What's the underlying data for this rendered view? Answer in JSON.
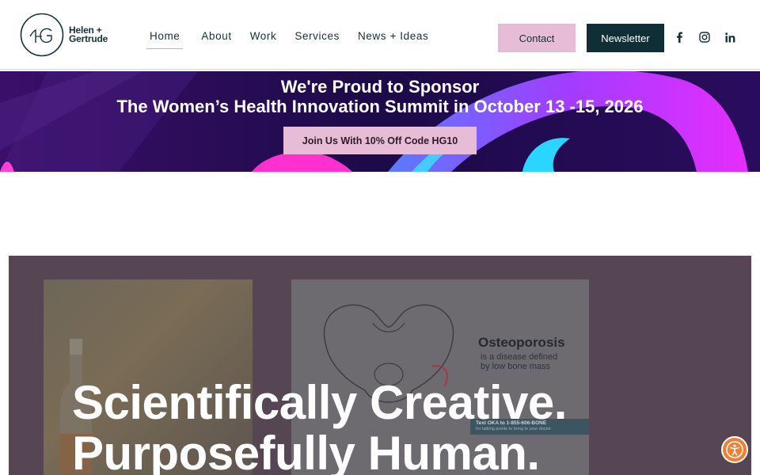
{
  "logo": {
    "monogram": "HG",
    "line1": "Helen +",
    "line2": "Gertrude"
  },
  "nav": {
    "items": [
      {
        "label": "Home",
        "active": true
      },
      {
        "label": "About"
      },
      {
        "label": "Work"
      },
      {
        "label": "Services"
      },
      {
        "label": "News + Ideas"
      }
    ]
  },
  "header": {
    "contact_label": "Contact",
    "newsletter_label": "Newsletter"
  },
  "social": [
    {
      "icon": "facebook-icon",
      "glyph": "f"
    },
    {
      "icon": "instagram-icon",
      "glyph": ""
    },
    {
      "icon": "linkedin-icon",
      "glyph": "in"
    }
  ],
  "banner": {
    "line1": "We're Proud to Sponsor",
    "line2": "The Women’s Health Innovation Summit in October 13 -15, 2026",
    "button_label": "Join Us With 10% Off Code HG10"
  },
  "hero": {
    "headline_line1": "Scientifically Creative.",
    "headline_line2": "Purposefully Human.",
    "card_title": "Osteoporosis",
    "card_sub1": "is a disease defined",
    "card_sub2": "by low bone mass",
    "card_strip1": "Text OKA to 1-855-606-BONE",
    "card_strip2": "for talking points to bring to your doctor"
  },
  "colors": {
    "brand_dark": "#0f2e36",
    "contact_pink": "#e7bcd7",
    "banner_purple": "#2a0b55",
    "hero_overlay": "#564553",
    "accessibility_orange": "#f07f32"
  }
}
